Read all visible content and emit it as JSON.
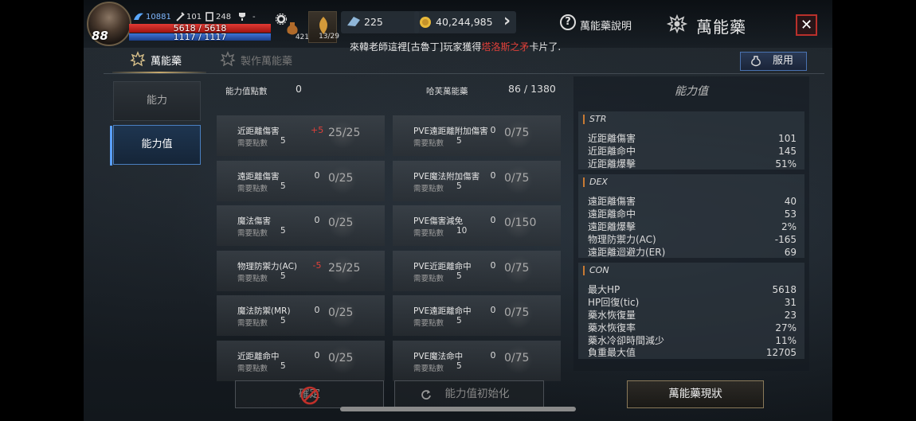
{
  "player": {
    "level": "88",
    "stat1": "10881",
    "stat2": "101",
    "stat3": "248",
    "stat4": "-",
    "hp_text": "5618 / 5618",
    "mp_text": "1117 / 1117",
    "hp_fraction": 1.0,
    "mp_fraction": 1.0
  },
  "slots": [
    {
      "count": "421"
    },
    {
      "count": "13/29"
    }
  ],
  "currency": {
    "crystals": "225",
    "gold": "40,244,985"
  },
  "header": {
    "help_label": "萬能藥說明",
    "title": "萬能藥",
    "help_symbol": "?",
    "close_symbol": "✕",
    "arrow_symbol": "›"
  },
  "ticker": {
    "prefix": "來韓老師這裡[古魯丁]玩家獲得",
    "highlight": "塔洛斯之矛",
    "suffix": "卡片了."
  },
  "tabs": [
    {
      "label": "萬能藥",
      "active": true
    },
    {
      "label": "製作萬能藥",
      "active": false
    }
  ],
  "use_button": "服用",
  "side_menu": [
    {
      "label": "能力",
      "active": false
    },
    {
      "label": "能力值",
      "active": true
    }
  ],
  "summary": {
    "points_label": "能力值點數",
    "points_value": "0",
    "potion_label": "哈芙萬能藥",
    "potion_value": "86 / 1380"
  },
  "req_label": "需要點數",
  "cards_left": [
    {
      "name": "近距離傷害",
      "req": "5",
      "add": "+5",
      "cap": "25/25",
      "tone": "pos"
    },
    {
      "name": "遠距離傷害",
      "req": "5",
      "add": "0",
      "cap": "0/25",
      "tone": ""
    },
    {
      "name": "魔法傷害",
      "req": "5",
      "add": "0",
      "cap": "0/25",
      "tone": ""
    },
    {
      "name": "物理防禦力(AC)",
      "req": "5",
      "add": "-5",
      "cap": "25/25",
      "tone": "neg"
    },
    {
      "name": "魔法防禦(MR)",
      "req": "5",
      "add": "0",
      "cap": "0/25",
      "tone": ""
    },
    {
      "name": "近距離命中",
      "req": "5",
      "add": "0",
      "cap": "0/25",
      "tone": ""
    }
  ],
  "cards_right": [
    {
      "name": "PVE遠距離附加傷害",
      "req": "5",
      "add": "0",
      "cap": "0/75",
      "tone": ""
    },
    {
      "name": "PVE魔法附加傷害",
      "req": "5",
      "add": "0",
      "cap": "0/75",
      "tone": ""
    },
    {
      "name": "PVE傷害減免",
      "req": "10",
      "add": "0",
      "cap": "0/150",
      "tone": ""
    },
    {
      "name": "PVE近距離命中",
      "req": "5",
      "add": "0",
      "cap": "0/75",
      "tone": ""
    },
    {
      "name": "PVE遠距離命中",
      "req": "5",
      "add": "0",
      "cap": "0/75",
      "tone": ""
    },
    {
      "name": "PVE魔法命中",
      "req": "5",
      "add": "0",
      "cap": "0/75",
      "tone": ""
    }
  ],
  "stats_panel": {
    "title": "能力值",
    "groups": [
      {
        "name": "STR",
        "rows": [
          {
            "label": "近距離傷害",
            "value": "101"
          },
          {
            "label": "近距離命中",
            "value": "145"
          },
          {
            "label": "近距離爆擊",
            "value": "51%"
          }
        ]
      },
      {
        "name": "DEX",
        "rows": [
          {
            "label": "遠距離傷害",
            "value": "40"
          },
          {
            "label": "遠距離命中",
            "value": "53"
          },
          {
            "label": "遠距離爆擊",
            "value": "2%"
          },
          {
            "label": "物理防禦力(AC)",
            "value": "-165"
          },
          {
            "label": "遠距離迴避力(ER)",
            "value": "69"
          }
        ]
      },
      {
        "name": "CON",
        "rows": [
          {
            "label": "最大HP",
            "value": "5618"
          },
          {
            "label": "HP回復(tic)",
            "value": "31"
          },
          {
            "label": "藥水恢復量",
            "value": "23"
          },
          {
            "label": "藥水恢復率",
            "value": "27%"
          },
          {
            "label": "藥水冷卻時間減少",
            "value": "11%"
          },
          {
            "label": "負重最大值",
            "value": "12705"
          }
        ]
      }
    ]
  },
  "bottom": {
    "confirm": "確定",
    "reset": "能力值初始化",
    "status": "萬能藥現狀"
  },
  "colors": {
    "accent_blue": "#4a7fc0",
    "hp_red": "#e23a34",
    "mp_blue": "#3f73d6",
    "gold": "#c8aa6e",
    "highlight_red": "#e0403a"
  }
}
